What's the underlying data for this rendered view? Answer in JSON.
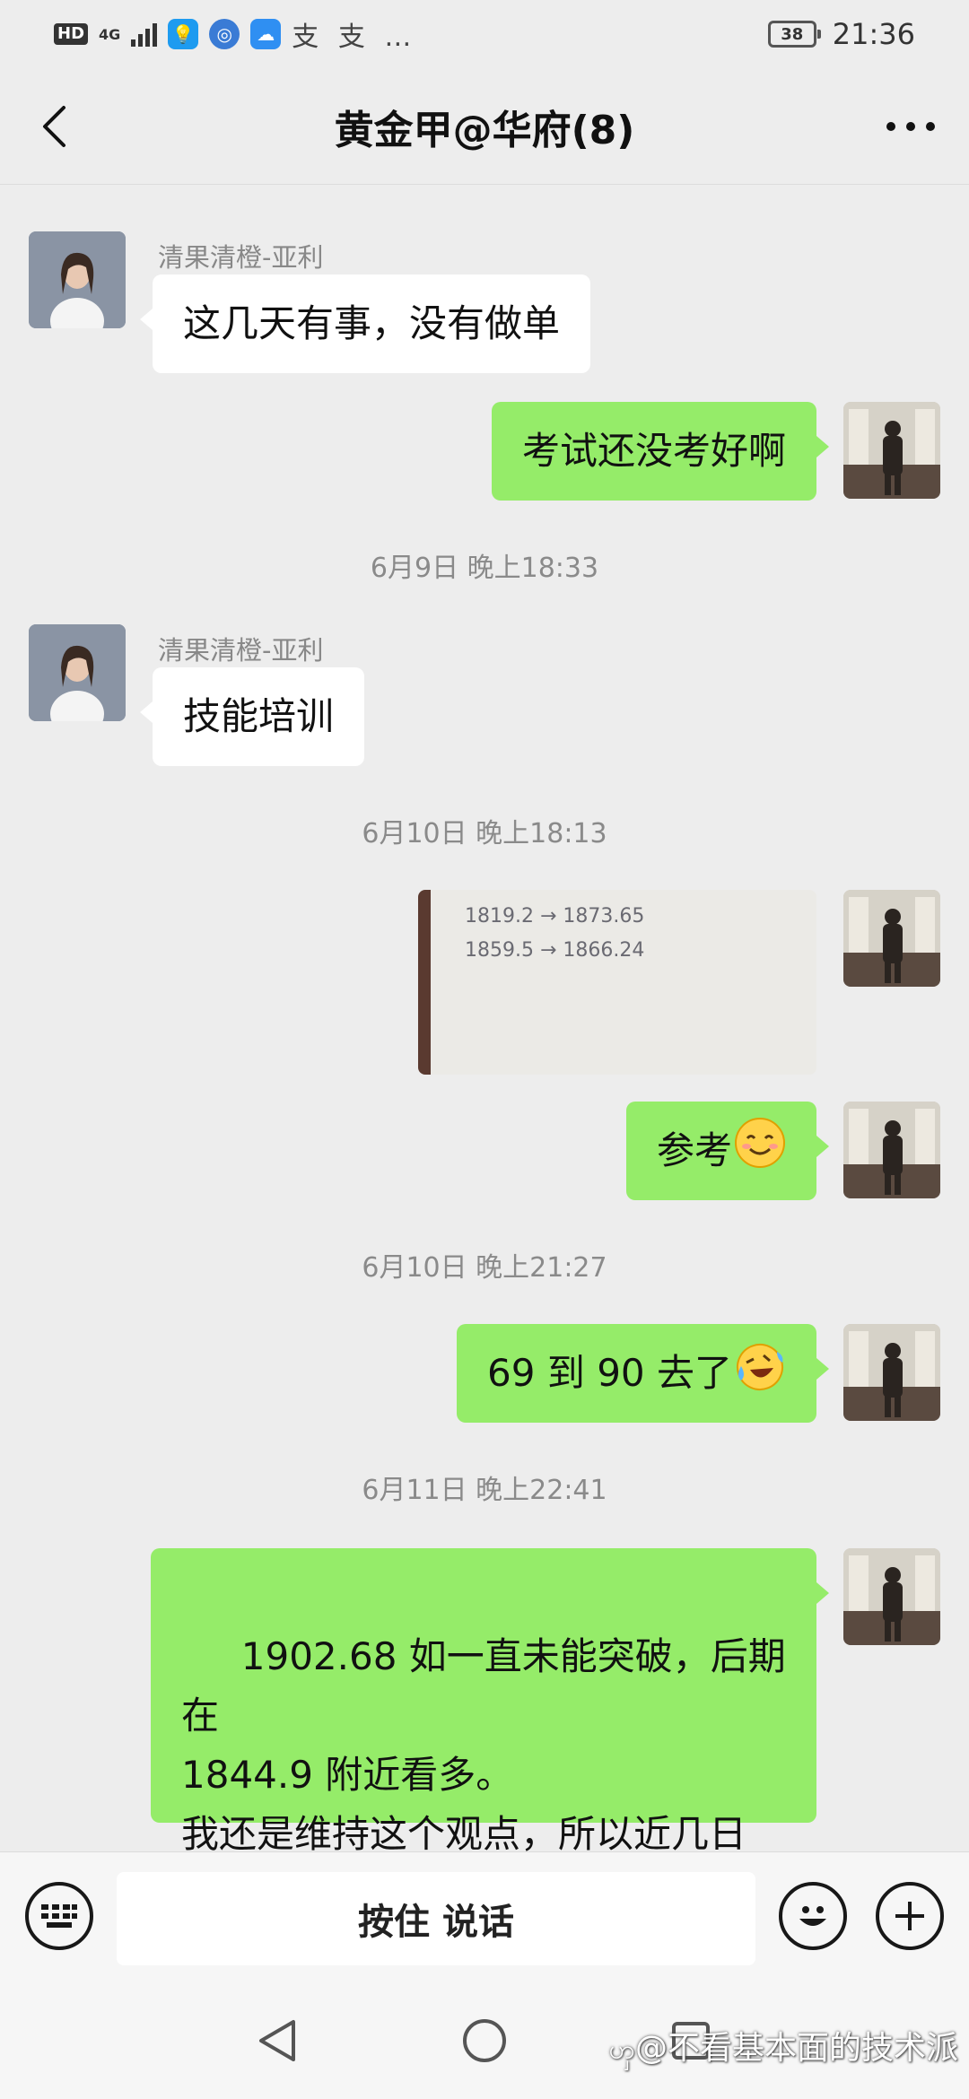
{
  "status_bar": {
    "hd_label": "HD",
    "network_label": "4G",
    "extra_icons_text": "支 支 …",
    "battery": "38",
    "time": "21:36"
  },
  "header": {
    "title": "黄金甲@华府(8)",
    "back_icon": "chevron-left-icon",
    "more_icon": "more-dots-icon"
  },
  "messages": [
    {
      "side": "left",
      "sender": "清果清橙-亚利",
      "text": "这几天有事，没有做单"
    },
    {
      "side": "right",
      "text": "考试还没考好啊"
    },
    {
      "type": "time",
      "text": "6月9日 晚上18:33"
    },
    {
      "side": "left",
      "sender": "清果清橙-亚利",
      "text": "技能培训"
    },
    {
      "type": "time",
      "text": "6月10日 晚上18:13"
    },
    {
      "side": "right",
      "type": "image",
      "image_lines": [
        "1819.2  →  1873.65",
        "1859.5  →  1866.24"
      ]
    },
    {
      "side": "right",
      "text": "参考",
      "emoji": "smiling-face-emoji"
    },
    {
      "type": "time",
      "text": "6月10日 晚上21:27"
    },
    {
      "side": "right",
      "text": "69 到 90 去了",
      "emoji": "laughing-crying-face-emoji"
    },
    {
      "type": "time",
      "text": "6月11日 晚上22:41"
    },
    {
      "side": "right",
      "text": " 1902.68 如一直未能突破，后期在\n1844.9 附近看多。\n我还是维持这个观点，所以近几日\n尽量不做多"
    }
  ],
  "input_bar": {
    "keyboard_icon": "keyboard-icon",
    "hold_to_talk": "按住 说话",
    "emoji_icon": "smiley-icon",
    "plus_icon": "plus-icon"
  },
  "nav_bar": {
    "back_icon": "triangle-back-icon",
    "home_icon": "circle-home-icon",
    "recents_icon": "square-recents-icon",
    "watermark": "@不看基本面的技术派"
  },
  "colors": {
    "background": "#ededed",
    "green_bubble": "#95ec69",
    "white_bubble": "#ffffff",
    "timestamp": "#8a8a8a"
  }
}
